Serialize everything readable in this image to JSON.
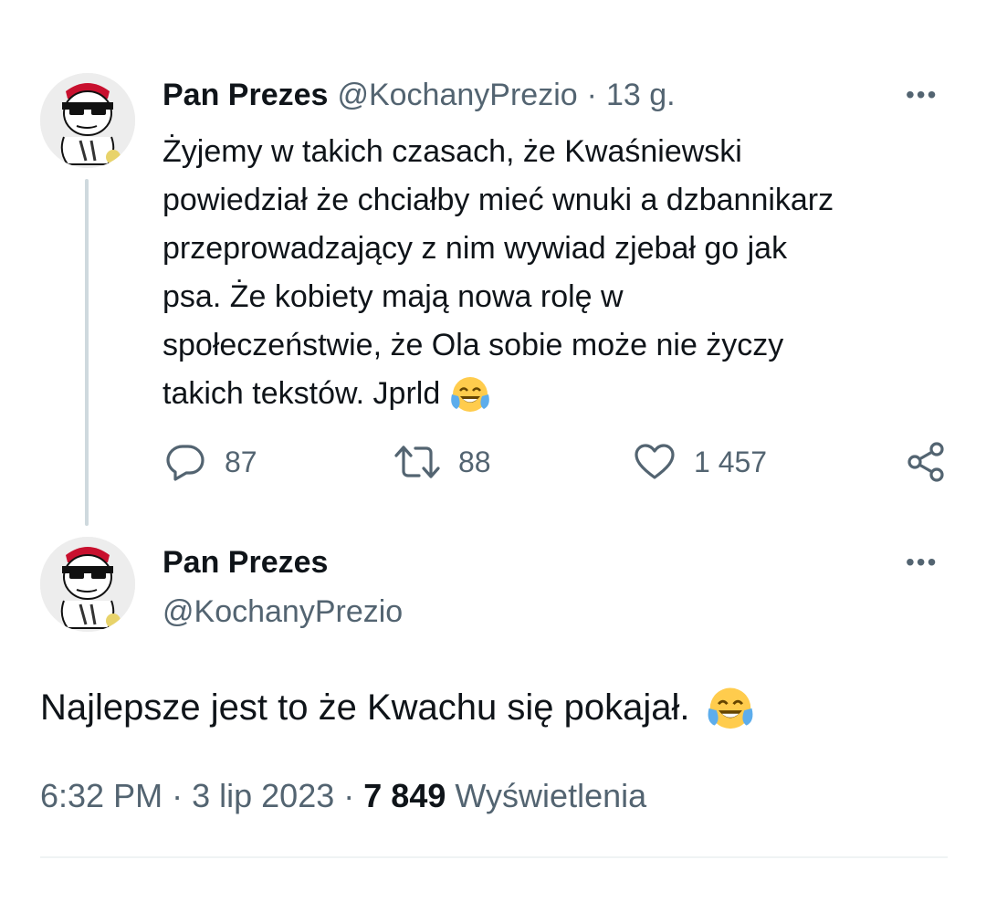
{
  "tweet1": {
    "author_name": "Pan Prezes",
    "author_handle": "@KochanyPrezio",
    "separator": "·",
    "time_ago": "13 g.",
    "more_label": "•••",
    "text_lines": [
      "Żyjemy w takich czasach, że Kwaśniewski",
      "powiedział że chciałby mieć wnuki a dzbannikarz",
      "przeprowadzający z nim wywiad zjebał go jak",
      "psa. Że kobiety mają nowa rolę w",
      "społeczeństwie, że Ola sobie może nie życzy",
      "takich tekstów. Jprld"
    ],
    "emoji": "face-with-tears-of-joy",
    "replies": "87",
    "retweets": "88",
    "likes": "1 457",
    "icons": [
      "reply-icon",
      "retweet-icon",
      "like-icon",
      "share-icon"
    ]
  },
  "tweet2": {
    "author_name": "Pan Prezes",
    "author_handle": "@KochanyPrezio",
    "more_label": "•••",
    "text": "Najlepsze jest to że Kwachu się pokajał.",
    "emoji": "face-with-tears-of-joy",
    "time": "6:32 PM",
    "separator": "·",
    "date": "3 lip 2023",
    "views_count": "7 849",
    "views_label": "Wyświetlenia"
  },
  "colors": {
    "text": "#0f1419",
    "secondary": "#536471",
    "thread_line": "#cfd9de",
    "divider": "#eff3f4",
    "emoji_face": "#ffcc4d",
    "emoji_tears": "#5dadec"
  }
}
